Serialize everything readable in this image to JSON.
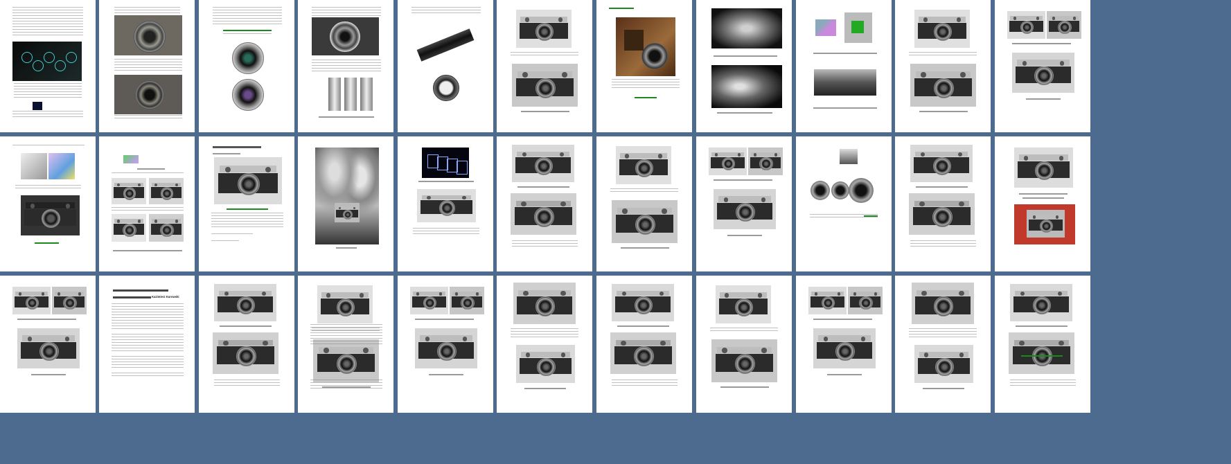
{
  "viewer": {
    "background": "#4d6a8f",
    "page_background": "#ffffff",
    "link_color": "#1a8a1a"
  },
  "page_text": {
    "r3p10_name": "Kazimierz Kurowski"
  },
  "pages": [
    {
      "row": 0,
      "col": 0,
      "kind": "text-diagram"
    },
    {
      "row": 0,
      "col": 1,
      "kind": "lens-photos"
    },
    {
      "row": 0,
      "col": 2,
      "kind": "lens-photos"
    },
    {
      "row": 0,
      "col": 3,
      "kind": "lens-photos"
    },
    {
      "row": 0,
      "col": 4,
      "kind": "telephoto"
    },
    {
      "row": 0,
      "col": 5,
      "kind": "camera-photos"
    },
    {
      "row": 0,
      "col": 6,
      "kind": "wood-camera"
    },
    {
      "row": 0,
      "col": 7,
      "kind": "xray-camera"
    },
    {
      "row": 0,
      "col": 8,
      "kind": "cutaway"
    },
    {
      "row": 0,
      "col": 9,
      "kind": "camera-photos"
    },
    {
      "row": 0,
      "col": 10,
      "kind": "camera-photos"
    },
    {
      "row": 1,
      "col": 0,
      "kind": "prism-diagram"
    },
    {
      "row": 1,
      "col": 1,
      "kind": "camera-grid"
    },
    {
      "row": 1,
      "col": 2,
      "kind": "heading-camera"
    },
    {
      "row": 1,
      "col": 3,
      "kind": "people-photo"
    },
    {
      "row": 1,
      "col": 4,
      "kind": "diagram-camera"
    },
    {
      "row": 1,
      "col": 5,
      "kind": "camera-photos"
    },
    {
      "row": 1,
      "col": 6,
      "kind": "camera-photos"
    },
    {
      "row": 1,
      "col": 7,
      "kind": "camera-photos"
    },
    {
      "row": 1,
      "col": 8,
      "kind": "lenses"
    },
    {
      "row": 1,
      "col": 9,
      "kind": "camera-photos"
    },
    {
      "row": 1,
      "col": 10,
      "kind": "red-camera"
    },
    {
      "row": 2,
      "col": 0,
      "kind": "camera-photos"
    },
    {
      "row": 2,
      "col": 1,
      "kind": "text-page"
    },
    {
      "row": 2,
      "col": 2,
      "kind": "camera-photos"
    },
    {
      "row": 2,
      "col": 3,
      "kind": "camera-photos"
    },
    {
      "row": 2,
      "col": 4,
      "kind": "camera-photos"
    },
    {
      "row": 2,
      "col": 5,
      "kind": "camera-photos"
    },
    {
      "row": 2,
      "col": 6,
      "kind": "camera-photos"
    },
    {
      "row": 2,
      "col": 7,
      "kind": "camera-photos"
    },
    {
      "row": 2,
      "col": 8,
      "kind": "camera-photos"
    },
    {
      "row": 2,
      "col": 9,
      "kind": "camera-photos"
    },
    {
      "row": 2,
      "col": 10,
      "kind": "camera-photos"
    }
  ]
}
